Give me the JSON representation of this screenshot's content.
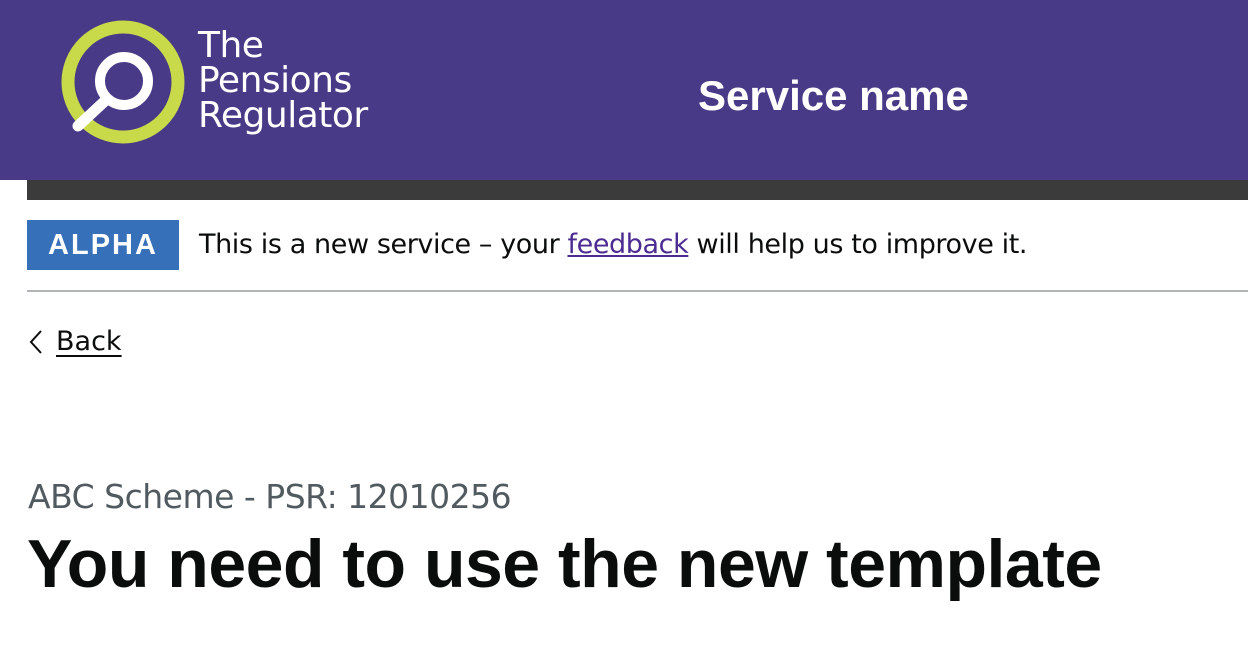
{
  "header": {
    "logo": {
      "line1": "The",
      "line2": "Pensions",
      "line3": "Regulator"
    },
    "service_name": "Service name",
    "brand_color": "#483a86",
    "logo_ring_color": "#c8d94a"
  },
  "phase_banner": {
    "tag": "ALPHA",
    "text_before": "This is a new service – your ",
    "link_text": "feedback",
    "text_after": " will help us to improve it.",
    "tag_color": "#3670b8"
  },
  "back_link": {
    "icon": "chevron-left-icon",
    "label": "Back"
  },
  "main": {
    "caption": "ABC Scheme - PSR: 12010256",
    "title": "You need to use the new template"
  }
}
